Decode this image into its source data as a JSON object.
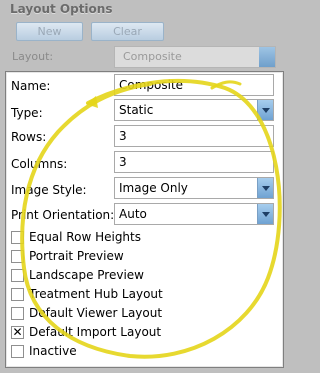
{
  "group_title": "Layout Options",
  "top_buttons": {
    "new_label": "New",
    "clear_label": "Clear"
  },
  "top_layout": {
    "label": "Layout:",
    "value": "Composite"
  },
  "form": {
    "name": {
      "label": "Name:",
      "value": "Composite"
    },
    "type": {
      "label": "Type:",
      "value": "Static"
    },
    "rows": {
      "label": "Rows:",
      "value": "3"
    },
    "columns": {
      "label": "Columns:",
      "value": "3"
    },
    "image_style": {
      "label": "Image Style:",
      "value": "Image Only"
    },
    "print_orientation": {
      "label": "Print Orientation:",
      "value": "Auto"
    }
  },
  "checkboxes": [
    {
      "label": "Equal Row Heights",
      "checked": false
    },
    {
      "label": "Portrait Preview",
      "checked": false
    },
    {
      "label": "Landscape Preview",
      "checked": false
    },
    {
      "label": "Treatment Hub Layout",
      "checked": false
    },
    {
      "label": "Default Viewer Layout",
      "checked": false
    },
    {
      "label": "Default Import Layout",
      "checked": true
    },
    {
      "label": "Inactive",
      "checked": false
    }
  ],
  "colors": {
    "highlight_circle": "#e4d51a",
    "combo_button": "#6fa2d2"
  }
}
